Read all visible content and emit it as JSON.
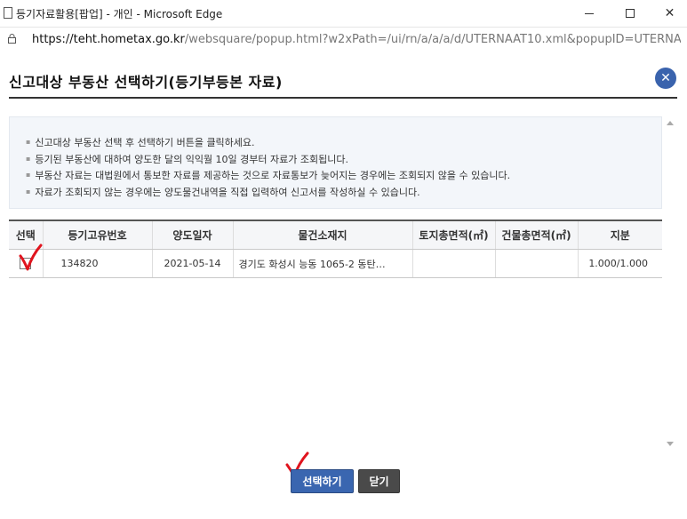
{
  "window": {
    "title": "등기자료활용[팝업] - 개인 - Microsoft Edge",
    "minimize_label": "—",
    "maximize_label": "☐",
    "close_label": "✕"
  },
  "address_bar": {
    "url_host": "https://teht.hometax.go.kr",
    "url_path": "/websquare/popup.html?w2xPath=/ui/rn/a/a/a/d/UTERNAAT10.xml&popupID=UTERNAAT..."
  },
  "popup": {
    "title": "신고대상 부동산 선택하기(등기부등본 자료)",
    "close_label": "✕"
  },
  "info": {
    "items": [
      "신고대상 부동산 선택 후 선택하기 버튼을 클릭하세요.",
      "등기된 부동산에 대하여 양도한 달의 익익월 10일 경부터 자료가 조회됩니다.",
      "부동산 자료는 대법원에서 통보한 자료를 제공하는 것으로 자료통보가 늦어지는 경우에는 조회되지 않을 수 있습니다.",
      "자료가 조회되지 않는 경우에는 양도물건내역을 직접 입력하여 신고서를 작성하실 수 있습니다."
    ]
  },
  "table": {
    "headers": [
      "선택",
      "등기고유번호",
      "양도일자",
      "물건소재지",
      "토지총면적(㎡)",
      "건물총면적(㎡)",
      "지분"
    ],
    "rows": [
      {
        "selected": false,
        "reg_no": "134820",
        "date": "2021-05-14",
        "address": "경기도 화성시 능동 1065-2 동탄…",
        "land_area": "",
        "building_area": "",
        "share": "1.000/1.000"
      }
    ]
  },
  "buttons": {
    "select_label": "선택하기",
    "close_label": "닫기"
  },
  "colors": {
    "accent_blue": "#3a66b0",
    "dark_button": "#4a4a4a",
    "annotation_red": "#e0141e",
    "info_bg": "#f3f6fa"
  }
}
